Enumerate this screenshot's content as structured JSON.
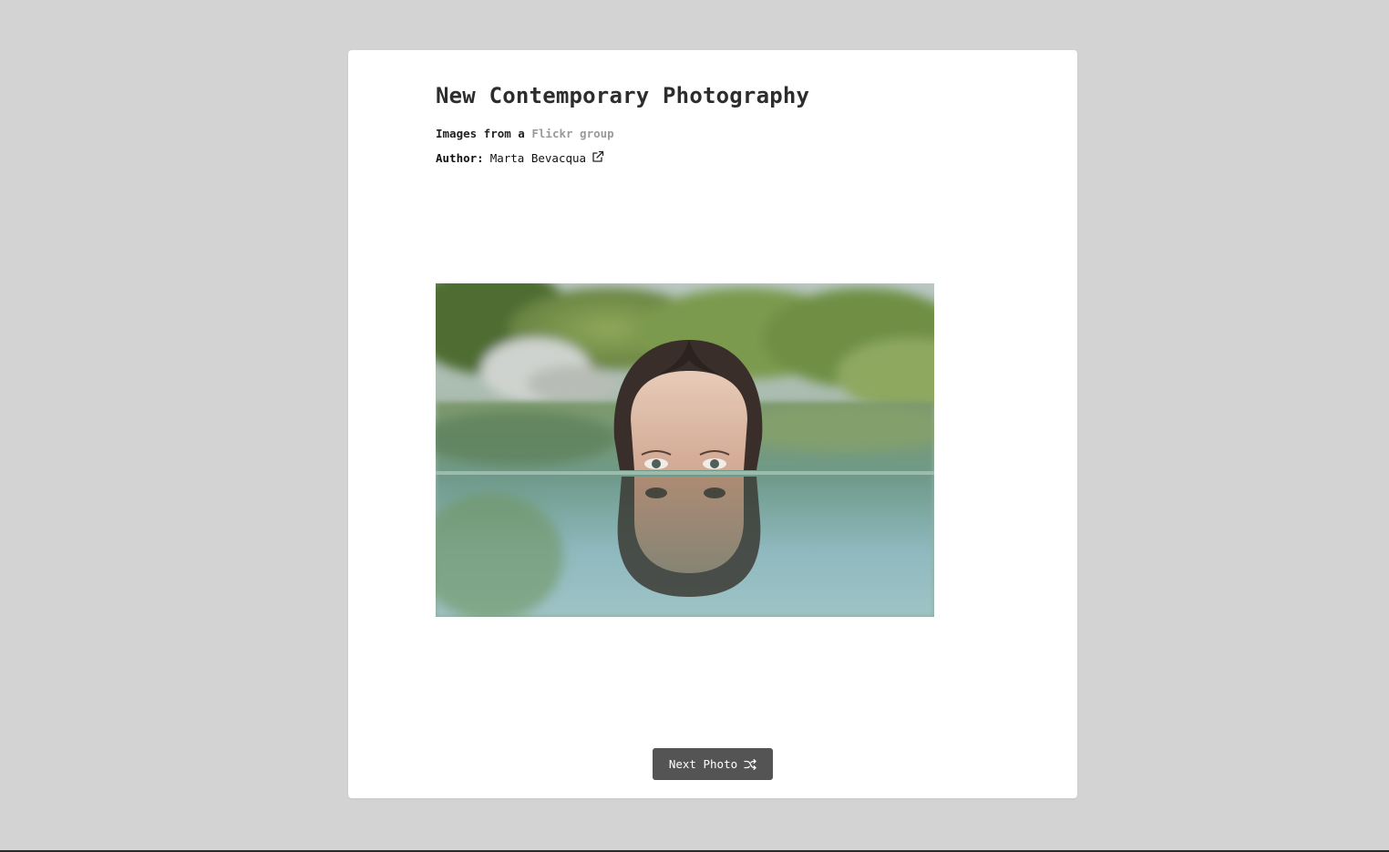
{
  "header": {
    "title": "New Contemporary Photography",
    "subtitle_prefix": "Images from a",
    "subtitle_link": "Flickr group",
    "author_label": "Author:",
    "author_name": "Marta Bevacqua"
  },
  "icons": {
    "external_link": "external-link-icon",
    "shuffle": "shuffle-icon"
  },
  "photo": {
    "alt": "Woman half-submerged in water with her reflection"
  },
  "controls": {
    "next_label": "Next Photo"
  },
  "colors": {
    "background": "#d3d3d3",
    "card": "#ffffff",
    "button": "#545454",
    "link": "#9a9a9a"
  }
}
